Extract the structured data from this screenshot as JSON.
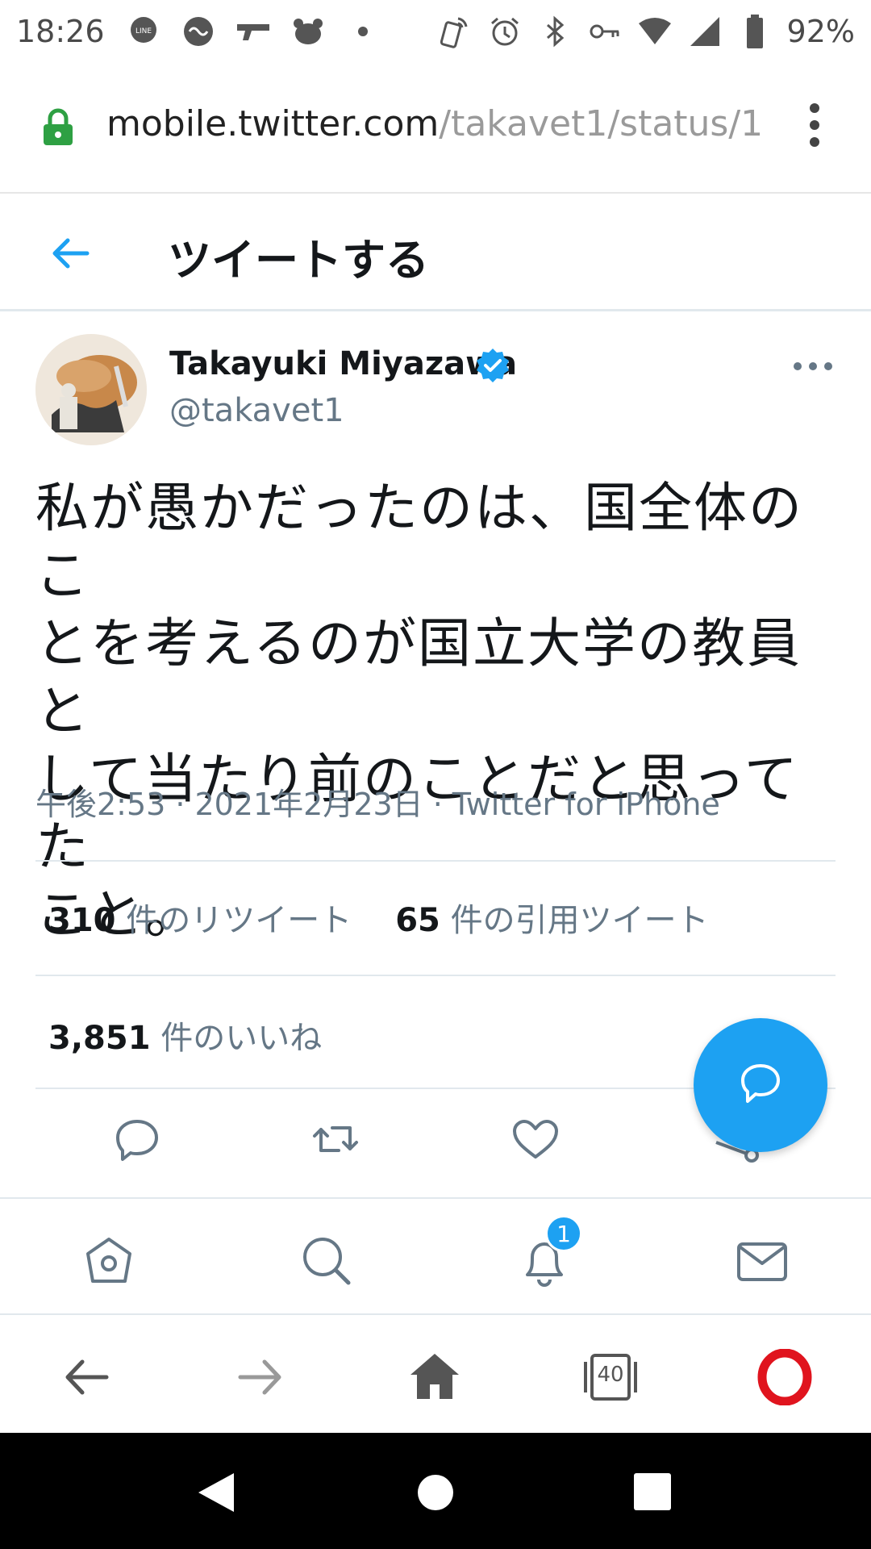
{
  "status_bar": {
    "time": "18:26",
    "battery": "92%",
    "icons": [
      "line-icon",
      "app-icon",
      "gun-icon",
      "bear-icon",
      "dot-icon",
      "nfc-icon",
      "alarm-icon",
      "bluetooth-icon",
      "key-icon",
      "wifi-icon",
      "signal-icon",
      "battery-icon"
    ]
  },
  "browser": {
    "url_host": "mobile.twitter.com",
    "url_path": "/takavet1/status/1",
    "tabs_count": "40"
  },
  "header": {
    "title": "ツイートする"
  },
  "tweet": {
    "author_name": "Takayuki Miyazawa",
    "handle": "@takavet1",
    "text_lines": [
      "私が愚かだったのは、国全体のこ",
      "とを考えるのが国立大学の教員と",
      "して当たり前のことだと思ってた",
      "こと。"
    ],
    "time": "午後2:53",
    "date": "2021年2月23日",
    "source": "Twitter for iPhone",
    "separator": "·",
    "retweets_count": "310",
    "retweets_label": "件のリツイート",
    "quotes_count": "65",
    "quotes_label": "件の引用ツイート",
    "likes_count": "3,851",
    "likes_label": "件のいいね"
  },
  "nav": {
    "notification_badge": "1"
  },
  "colors": {
    "accent": "#1da1f2",
    "text": "#14171a",
    "muted": "#657786",
    "lock": "#2ea043",
    "opera": "#e0141e"
  }
}
